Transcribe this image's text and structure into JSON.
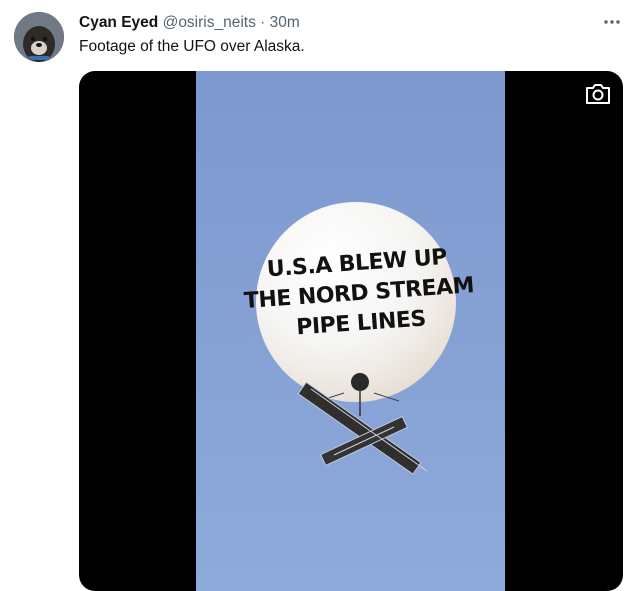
{
  "tweet": {
    "author_name": "Cyan Eyed",
    "handle": "@osiris_neits",
    "separator": " · ",
    "time": "30m",
    "text": "Footage of the UFO over Alaska.",
    "more_icon": "more-horizontal-icon"
  },
  "media": {
    "overlay_lines": [
      "U.S.A BLEW UP",
      "THE NORD STREAM",
      "PIPE LINES"
    ],
    "camera_icon": "camera-icon"
  },
  "colors": {
    "sky": "#87a3d6",
    "letterbox": "#000000",
    "text_primary": "#0f1419",
    "text_secondary": "#536471"
  }
}
